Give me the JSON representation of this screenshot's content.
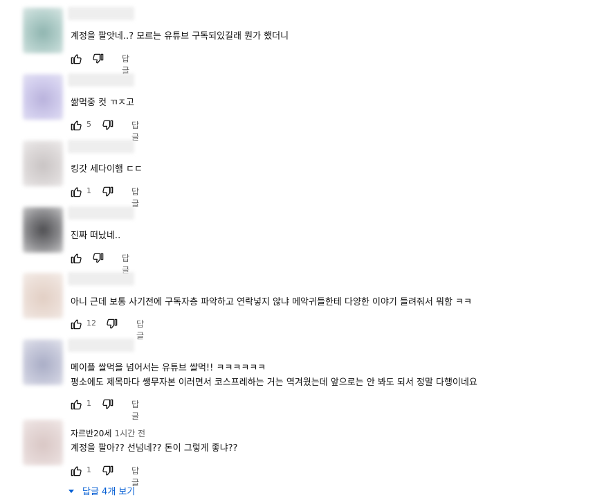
{
  "icons": {
    "like": "thumb-up-icon",
    "dislike": "thumb-down-icon",
    "expand": "caret-down-icon"
  },
  "colors": {
    "link": "#065fd4",
    "meta": "#606060",
    "text": "#0f0f0f"
  },
  "reply_label": "답글",
  "comments": [
    {
      "author": "",
      "time": "",
      "lines": [
        "계정을 팔앗네..? 모르는 유튜브 구독되있길래 뭔가 했더니"
      ],
      "likes": ""
    },
    {
      "author": "",
      "time": "",
      "lines": [
        "쌂먹중 컷 ㄲㅈ고"
      ],
      "likes": "5"
    },
    {
      "author": "",
      "time": "",
      "lines": [
        "킹갓 세다이햄 ㄷㄷ"
      ],
      "likes": "1"
    },
    {
      "author": "",
      "time": "",
      "lines": [
        "진짜 떠났네.."
      ],
      "likes": ""
    },
    {
      "author": "",
      "time": "",
      "lines": [
        "아니 근데 보통 사기전에 구독자층 파악하고 연락넣지 않냐 메악귀들한테 다양한 이야기 들려줘서 뭐함 ㅋㅋ"
      ],
      "likes": "12"
    },
    {
      "author": "",
      "time": "",
      "lines": [
        "메이플 쌀먹을 넘어서는 유튜브 쌀먹!! ㅋㅋㅋㅋㅋㅋ",
        "평소에도 제목마다 쌩무자본 이러면서  코스프레하는 거는 역겨웠는데 앞으로는 안 봐도 되서 정말 다행이네요"
      ],
      "likes": "1"
    },
    {
      "author": "자르반20세",
      "time": "1시간 전",
      "lines": [
        "계정을 팔아?? 선넘네?? 돈이 그렇게 좋냐??"
      ],
      "likes": "1"
    }
  ],
  "view_replies": "답글 4개 보기"
}
